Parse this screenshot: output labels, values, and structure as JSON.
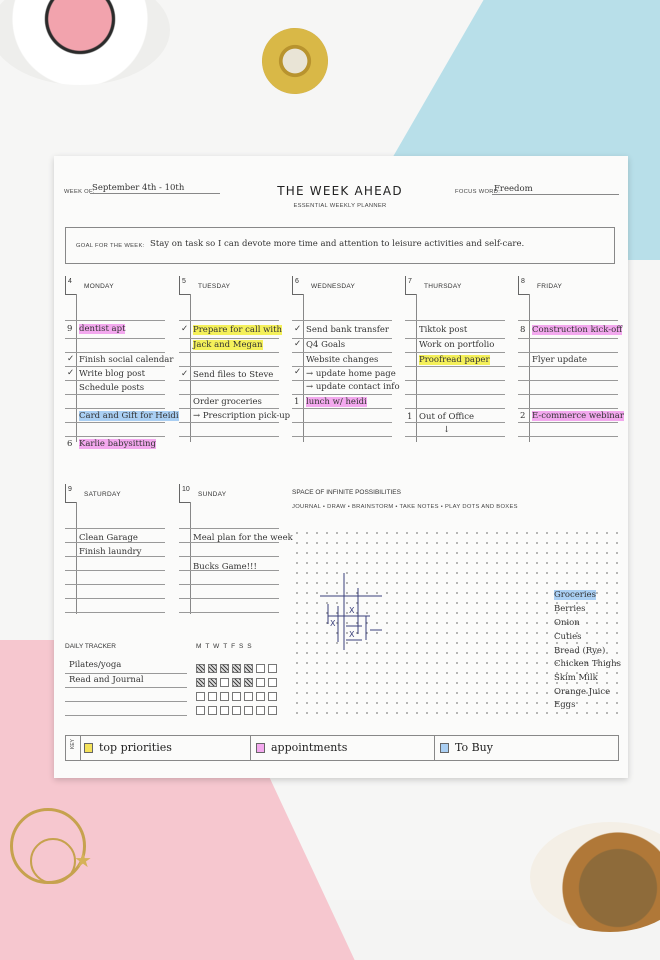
{
  "header": {
    "week_of_label": "WEEK OF:",
    "week_of_value": "September 4th - 10th",
    "title": "THE WEEK AHEAD",
    "subtitle": "ESSENTIAL WEEKLY PLANNER",
    "focus_label": "FOCUS WORD:",
    "focus_value": "Freedom"
  },
  "goal": {
    "label": "GOAL FOR THE WEEK:",
    "text": "Stay on task so I can devote more time and attention to leisure activities and self-care."
  },
  "days": [
    {
      "num": "4",
      "name": "MONDAY"
    },
    {
      "num": "5",
      "name": "TUESDAY"
    },
    {
      "num": "6",
      "name": "WEDNESDAY"
    },
    {
      "num": "7",
      "name": "THURSDAY"
    },
    {
      "num": "8",
      "name": "FRIDAY"
    },
    {
      "num": "9",
      "name": "SATURDAY"
    },
    {
      "num": "10",
      "name": "SUNDAY"
    }
  ],
  "monday": {
    "m1": "9",
    "e1": "dentist apt",
    "e2": "Finish social calendar",
    "e3": "Write blog post",
    "e4": "Schedule posts",
    "e5": "Card and Gift for Heidi",
    "m6": "6",
    "e6": "Karlie babysitting"
  },
  "tuesday": {
    "e1": "Prepare for call with",
    "e2": "Jack and Megan",
    "e3": "Send files to Steve",
    "e4": "Order groceries",
    "e5": "→ Prescription pick-up"
  },
  "wednesday": {
    "e1": "Send bank transfer",
    "e2": "Q4 Goals",
    "e3": "Website changes",
    "e4": "→ update home page",
    "e5": "→ update contact info",
    "m6": "1",
    "e6": "lunch w/ heidi"
  },
  "thursday": {
    "e1": "Tiktok post",
    "e2": "Work on portfolio",
    "e3": "Proofread paper",
    "m4": "1",
    "e4": "Out of Office",
    "arrow": "↓"
  },
  "friday": {
    "m1": "8",
    "e1": "Construction kick-off",
    "e2": "Flyer update",
    "m3": "2",
    "e3": "E-commerce webinar"
  },
  "saturday": {
    "e1": "Clean Garage",
    "e2": "Finish laundry"
  },
  "sunday": {
    "e1": "Meal plan for the week",
    "e2": "Bucks Game!!!"
  },
  "check": "✓",
  "space": {
    "title": "SPACE OF INFINITE POSSIBILITIES",
    "subtitle": "JOURNAL • DRAW • BRAINSTORM • TAKE NOTES • PLAY DOTS AND BOXES",
    "groceries": [
      "Groceries",
      "Berries",
      "Onion",
      "Cuties",
      "Bread (Rye)",
      "Chicken Thighs",
      "Skim Milk",
      "Orange Juice",
      "Eggs"
    ],
    "x_mark": "X"
  },
  "tracker": {
    "title": "DAILY TRACKER",
    "days": "MTWTFSS",
    "habits": [
      "Pilates/yoga",
      "Read and Journal"
    ]
  },
  "key": {
    "label": "KEY",
    "items": [
      "top priorities",
      "appointments",
      "To Buy"
    ],
    "colors": [
      "#f4e25a",
      "#f3a8ee",
      "#aacff3"
    ]
  }
}
